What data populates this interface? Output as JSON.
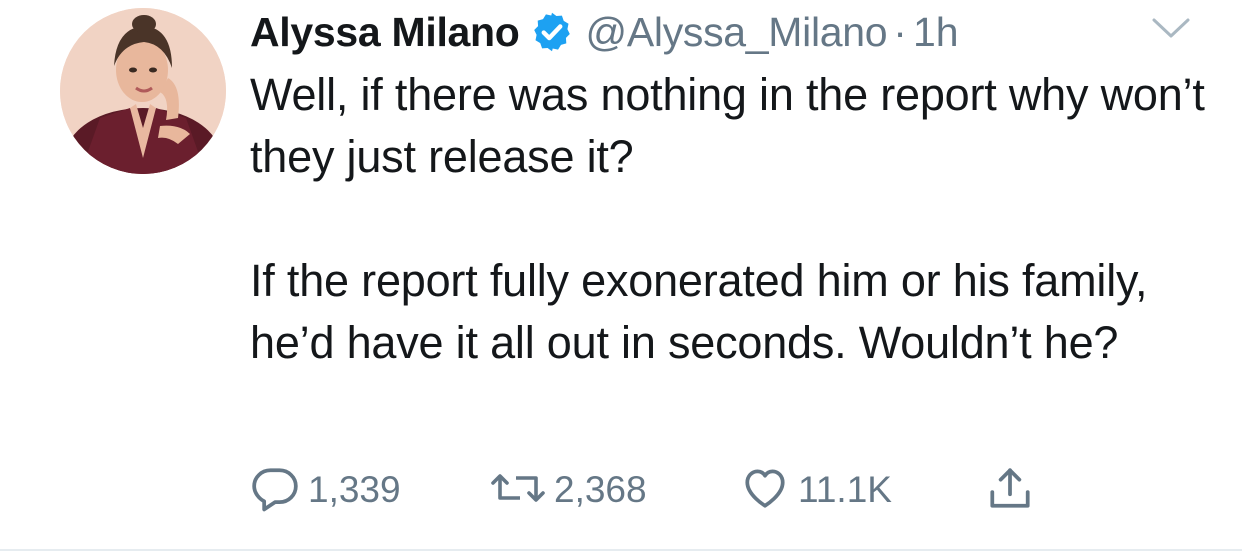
{
  "tweet": {
    "author": {
      "display_name": "Alyssa Milano",
      "handle": "@Alyssa_Milano",
      "verified": true,
      "verified_color": "#1da1f2"
    },
    "separator": "·",
    "time": "1h",
    "paragraphs": [
      "Well, if there was nothing in the report why won’t they just release it?",
      "If the report fully exonerated him or his family, he’d have it all out in seconds. Wouldn’t he?"
    ],
    "actions": {
      "replies": "1,339",
      "retweets": "2,368",
      "likes": "11.1K"
    },
    "icons": {
      "avatar": "profile-photo",
      "verified": "verified-badge-icon",
      "caret": "chevron-down-icon",
      "reply": "reply-icon",
      "retweet": "retweet-icon",
      "like": "heart-icon",
      "share": "share-icon"
    },
    "colors": {
      "text": "#14171a",
      "secondary": "#657786"
    }
  }
}
